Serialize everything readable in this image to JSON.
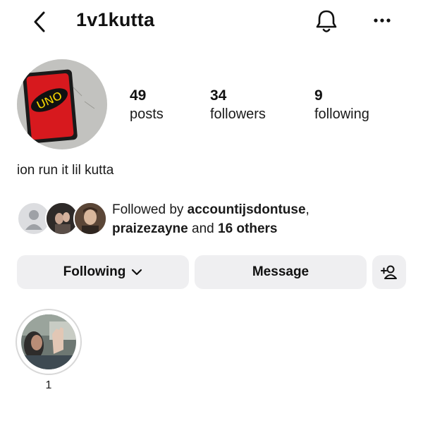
{
  "header": {
    "username": "1v1kutta",
    "icons": {
      "back": "chevron-left-icon",
      "notifications": "bell-icon",
      "more": "more-horizontal-icon"
    }
  },
  "profile": {
    "avatar_text": "UNO",
    "stats": [
      {
        "value": "49",
        "label": "posts"
      },
      {
        "value": "34",
        "label": "followers"
      },
      {
        "value": "9",
        "label": "following"
      }
    ],
    "bio": "ion run it lil kutta"
  },
  "mutuals": {
    "prefix": "Followed by ",
    "name1": "accountijsdontuse",
    "sep": ",",
    "name2": "praizezayne",
    "and": " and ",
    "others": "16 others"
  },
  "actions": {
    "following_label": "Following",
    "message_label": "Message",
    "add_user_icon": "add-user-icon"
  },
  "highlights": [
    {
      "label": "1"
    }
  ],
  "colors": {
    "button_bg": "#efeff1",
    "uno_red": "#d7191e",
    "uno_yellow": "#f5d400"
  }
}
